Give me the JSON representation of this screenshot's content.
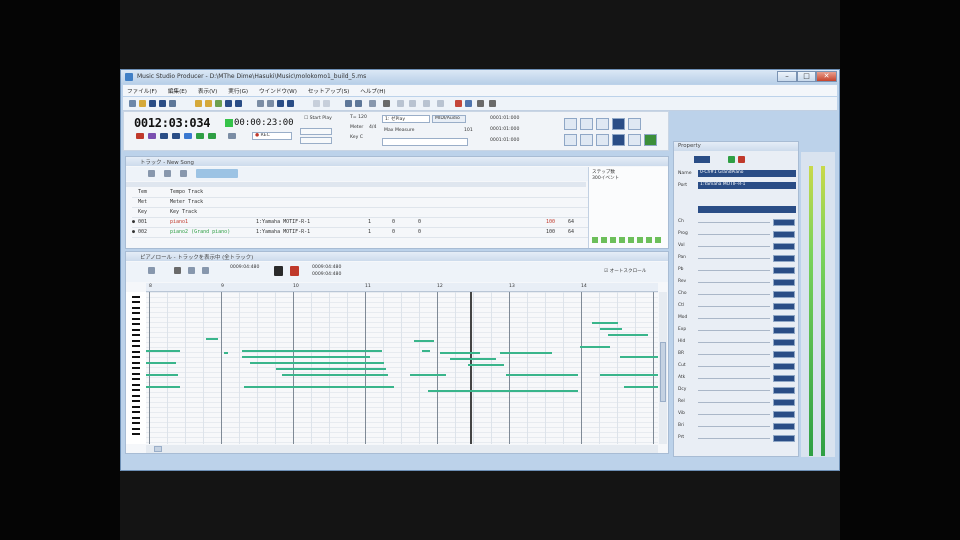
{
  "window": {
    "title": "Music Studio Producer - D:\\MThe Dime\\Hasuki\\Music\\molokomo1_build_5.ms",
    "minimize_glyph": "–",
    "maximize_glyph": "□",
    "close_glyph": "✕"
  },
  "menu": [
    "ファイル(F)",
    "編集(E)",
    "表示(V)",
    "実行(G)",
    "ウインドウ(W)",
    "セットアップ(S)",
    "ヘルプ(H)"
  ],
  "transport": {
    "position": "0012:03:034",
    "time": "00:00:23:00",
    "start_play_label": "Start Play",
    "record_label": "REC",
    "tempo_label": "T= 120",
    "meter_label": "Meter",
    "meter_value": "4/4",
    "key_label": "Key C",
    "play_mode": "1: ゼPlay",
    "midi_label": "MIDI/Audio",
    "max_measure_label": "Max Measure",
    "max_measure_value": "101",
    "loc1": "0001:01:000",
    "loc2": "0001:01:000",
    "loc3": "0001:01:000"
  },
  "track_window": {
    "title": "トラック - New Song",
    "side_label_1": "ステップ数",
    "side_label_2": "300イベント",
    "tracks": [
      {
        "num": "Tem",
        "name": "Tempo Track",
        "port": "",
        "ch": "",
        "prog": "",
        "vol": "",
        "pan": ""
      },
      {
        "num": "Met",
        "name": "Meter Track",
        "port": "",
        "ch": "",
        "prog": "",
        "vol": "",
        "pan": ""
      },
      {
        "num": "Key",
        "name": "Key Track",
        "port": "",
        "ch": "",
        "prog": "",
        "vol": "",
        "pan": ""
      },
      {
        "num": "001",
        "name": "piano1",
        "port": "1:Yamaha MOTIF-R-1",
        "ch": "1",
        "prog": "0",
        "vol": "100",
        "pan": "64"
      },
      {
        "num": "002",
        "name": "piano2 (Grand piano)",
        "port": "1:Yamaha MOTIF-R-1",
        "ch": "1",
        "prog": "0",
        "vol": "100",
        "pan": "64"
      }
    ]
  },
  "piano_roll": {
    "title": "ピアノロール - トラックを表示中 (全トラック)",
    "pos1": "0009:04:480",
    "pos2": "0009:04:480",
    "pos3": "0009:04:480",
    "auto_scroll_label": "オートスクロール",
    "measures": [
      "8",
      "9",
      "10",
      "11",
      "12",
      "13",
      "14"
    ]
  },
  "property": {
    "title": "Property",
    "name_value": "0-Ch#1 GrandPiano",
    "port_value": "1:Yamaha MOTIF-R-1",
    "rows": [
      "Ch",
      "Prog",
      "Vol",
      "Pan",
      "Pb",
      "Rev",
      "Cho",
      "Ctl",
      "Mod",
      "Exp",
      "Hld",
      "BR",
      "Cut",
      "Atk",
      "Dcy",
      "Rel",
      "Vib",
      "Bri",
      "Prt"
    ]
  },
  "colors": {
    "accent": "#2f6fbf",
    "note": "#39b58b",
    "meter_green": "#4fbf5a",
    "close_red": "#c6432b"
  },
  "icons": {
    "transport_play": "play-icon",
    "transport_stop": "stop-icon",
    "transport_rec": "record-icon"
  }
}
